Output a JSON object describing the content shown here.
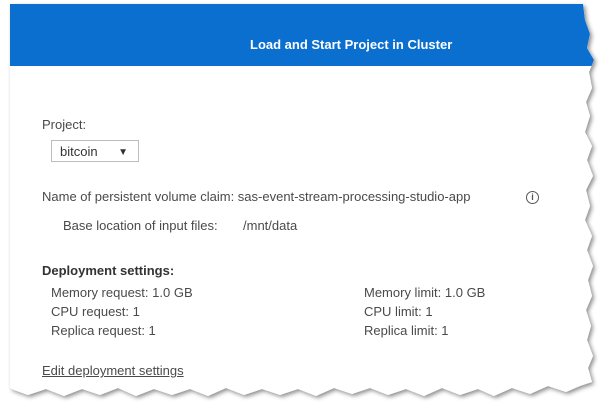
{
  "dialog": {
    "title": "Load and Start Project in Cluster",
    "header_color": "#0b6fd0"
  },
  "project": {
    "label": "Project:",
    "selected": "bitcoin"
  },
  "pvc": {
    "label": "Name of persistent volume claim: sas-event-stream-processing-studio-app",
    "info_icon": "info-icon"
  },
  "input_files": {
    "label": "Base location of input files:",
    "value": "/mnt/data"
  },
  "deployment": {
    "heading": "Deployment settings:",
    "memory_request": "Memory request: 1.0 GB",
    "cpu_request": "CPU request: 1",
    "replica_request": "Replica request: 1",
    "memory_limit": "Memory limit: 1.0 GB",
    "cpu_limit": "CPU limit: 1",
    "replica_limit": "Replica limit: 1",
    "edit_link": "Edit deployment settings"
  }
}
